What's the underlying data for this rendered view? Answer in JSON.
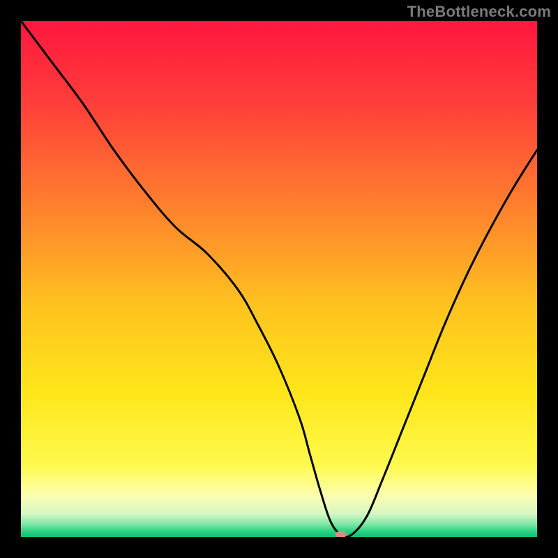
{
  "watermark": "TheBottleneck.com",
  "chart_data": {
    "type": "line",
    "title": "",
    "xlabel": "",
    "ylabel": "",
    "xlim": [
      0,
      100
    ],
    "ylim": [
      0,
      100
    ],
    "grid": false,
    "legend": false,
    "gradient_stops": [
      {
        "offset": 0.0,
        "color": "#ff173f"
      },
      {
        "offset": 0.15,
        "color": "#ff3b3a"
      },
      {
        "offset": 0.35,
        "color": "#ff7d2e"
      },
      {
        "offset": 0.55,
        "color": "#ffc21f"
      },
      {
        "offset": 0.72,
        "color": "#ffe61a"
      },
      {
        "offset": 0.86,
        "color": "#fff94d"
      },
      {
        "offset": 0.92,
        "color": "#fcffb0"
      },
      {
        "offset": 0.955,
        "color": "#d6f7c3"
      },
      {
        "offset": 0.975,
        "color": "#7de8a6"
      },
      {
        "offset": 0.99,
        "color": "#25d07e"
      },
      {
        "offset": 1.0,
        "color": "#0fbf70"
      }
    ],
    "series": [
      {
        "name": "curve",
        "color": "#000000",
        "x": [
          0,
          6,
          12,
          18,
          24,
          30,
          36,
          42,
          46,
          50,
          54,
          56,
          58,
          60,
          62,
          64,
          67,
          70,
          74,
          78,
          82,
          86,
          90,
          95,
          100
        ],
        "y": [
          100,
          92,
          84,
          75,
          67,
          60,
          55,
          48,
          41,
          33,
          23,
          16,
          9,
          3,
          0.5,
          0.4,
          4,
          11,
          21,
          31,
          41,
          50,
          58,
          67,
          75
        ]
      }
    ],
    "marker": {
      "name": "highlight-marker",
      "x": 62,
      "y": 0.5,
      "color": "#d98a85",
      "rx": 8,
      "ry": 5
    }
  }
}
